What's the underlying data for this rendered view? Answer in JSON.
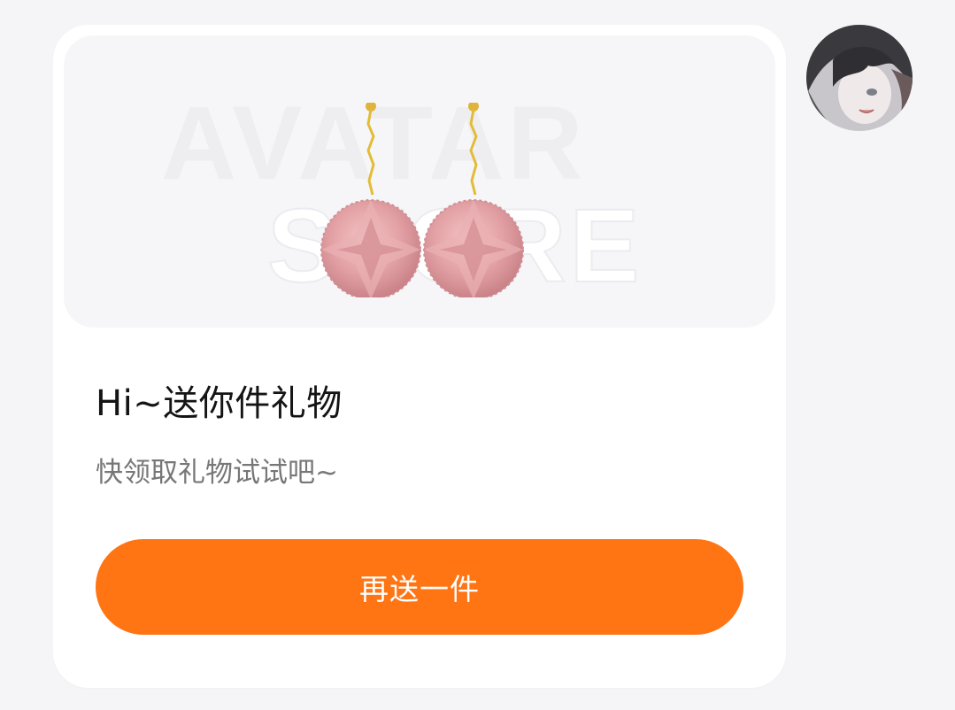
{
  "message": {
    "title": "Hi~送你件礼物",
    "subtitle": "快领取礼物试试吧~",
    "button_label": "再送一件",
    "watermark_line1": "AVATAR",
    "watermark_line2": "STORE"
  },
  "gift": {
    "icon": "earrings-icon",
    "color": "#e8a3a8"
  },
  "colors": {
    "accent": "#ff7413",
    "background": "#f5f5f7",
    "card": "#ffffff"
  },
  "sender": {
    "avatar_icon": "avatar-icon"
  }
}
